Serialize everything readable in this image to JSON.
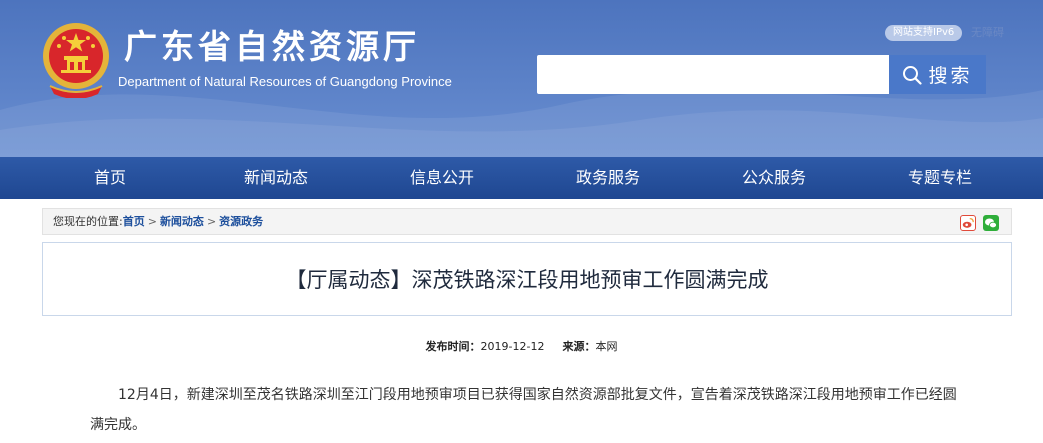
{
  "header": {
    "title_cn": "广东省自然资源厅",
    "title_en": "Department of Natural Resources of Guangdong Province",
    "ipv6_badge": "网站支持IPv6",
    "top_link": "无障碍",
    "emblem_icon": "national-emblem-icon"
  },
  "search": {
    "placeholder": "",
    "button_label": "搜索",
    "icon": "search-icon"
  },
  "nav": {
    "items": [
      {
        "label": "首页"
      },
      {
        "label": "新闻动态"
      },
      {
        "label": "信息公开"
      },
      {
        "label": "政务服务"
      },
      {
        "label": "公众服务"
      },
      {
        "label": "专题专栏"
      }
    ]
  },
  "breadcrumb": {
    "prefix": "您现在的位置:",
    "items": [
      {
        "label": "首页"
      },
      {
        "label": "新闻动态"
      },
      {
        "label": "资源政务"
      }
    ],
    "separator": ">",
    "share_icons": [
      "weibo-share-icon",
      "wechat-share-icon"
    ]
  },
  "article": {
    "title": "【厅属动态】深茂铁路深江段用地预审工作圆满完成",
    "publish_label": "发布时间：",
    "publish_date": "2019-12-12",
    "source_label": "来源：",
    "source_value": "本网",
    "paragraph": "12月4日，新建深圳至茂名铁路深圳至江门段用地预审项目已获得国家自然资源部批复文件，宣告着深茂铁路深江段用地预审工作已经圆满完成。"
  },
  "colors": {
    "header_bg": "#5a80c6",
    "nav_bg": "#2a53a0",
    "search_button": "#4a78c9",
    "link": "#1d4f9c"
  }
}
